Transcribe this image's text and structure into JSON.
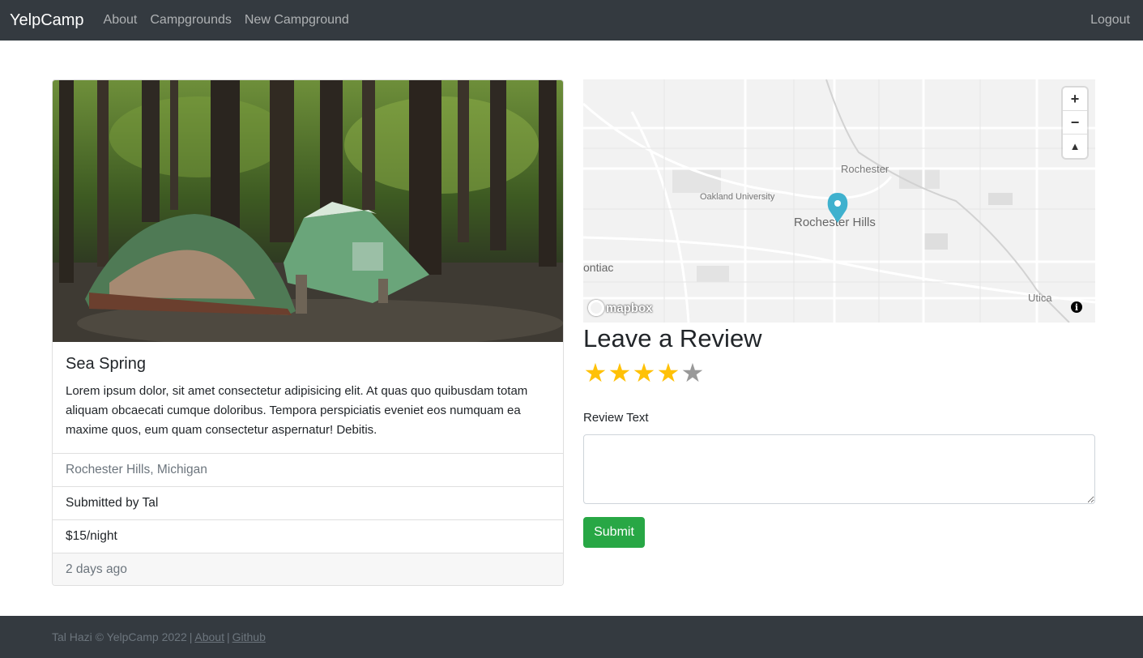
{
  "navbar": {
    "brand": "YelpCamp",
    "links": [
      "About",
      "Campgrounds",
      "New Campground"
    ],
    "logout": "Logout"
  },
  "campground": {
    "title": "Sea Spring",
    "description": "Lorem ipsum dolor, sit amet consectetur adipisicing elit. At quas quo quibusdam totam aliquam obcaecati cumque doloribus. Tempora perspiciatis eveniet eos numquam ea maxime quos, eum quam consectetur aspernatur! Debitis.",
    "location": "Rochester Hills, Michigan",
    "submitted_by": "Submitted by Tal",
    "price": "$15/night",
    "posted": "2 days ago"
  },
  "map": {
    "labels": {
      "rochester": "Rochester",
      "oakland": "Oakland University",
      "rochester_hills": "Rochester Hills",
      "pontiac": "ontiac",
      "utica": "Utica"
    },
    "zoom_in": "+",
    "zoom_out": "−",
    "compass": "▲",
    "logo": "mapbox",
    "info": "i"
  },
  "review": {
    "title": "Leave a Review",
    "rating": 4,
    "max_rating": 5,
    "text_label": "Review Text",
    "text_value": "",
    "submit": "Submit"
  },
  "footer": {
    "copyright": "Tal Hazi © YelpCamp 2022",
    "about": "About",
    "github": "Github",
    "separator": "|"
  },
  "colors": {
    "navbar_bg": "#343a40",
    "star_filled": "#ffc107",
    "star_empty": "#999999",
    "submit_bg": "#28a745",
    "marker": "#3fb1ce"
  }
}
